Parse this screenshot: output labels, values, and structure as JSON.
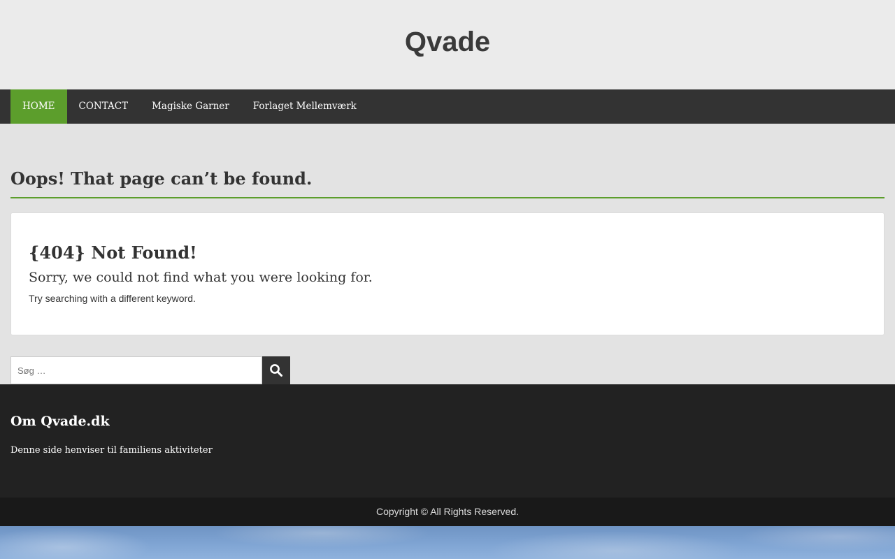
{
  "header": {
    "site_title": "Qvade"
  },
  "nav": {
    "items": [
      {
        "label": "HOME",
        "active": true
      },
      {
        "label": "CONTACT",
        "active": false
      },
      {
        "label": "Magiske Garner",
        "active": false
      },
      {
        "label": "Forlaget Mellemværk",
        "active": false
      }
    ]
  },
  "main": {
    "page_title": "Oops! That page can’t be found.",
    "notfound": {
      "heading": "{404} Not Found!",
      "subheading": "Sorry, we could not find what you were looking for.",
      "hint": "Try searching with a different keyword."
    },
    "search": {
      "placeholder": "Søg …",
      "value": "",
      "button_icon": "search-icon"
    }
  },
  "footer": {
    "widget_title": "Om Qvade.dk",
    "widget_text": "Denne side henviser til familiens aktiviteter",
    "copyright": "Copyright © All Rights Reserved."
  },
  "colors": {
    "accent": "#5c9e2c",
    "nav_bg": "#333333",
    "footer_bg": "#222222",
    "footer_bottom_bg": "#191919"
  }
}
